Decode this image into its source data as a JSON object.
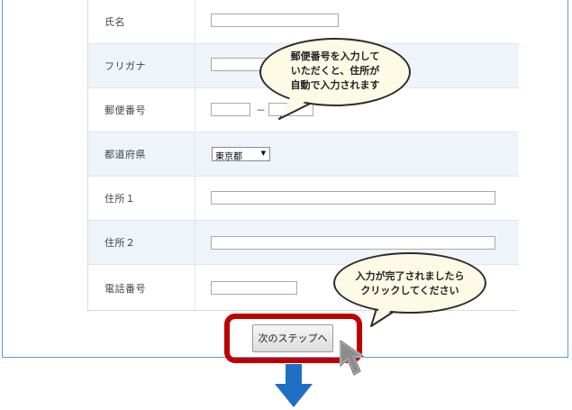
{
  "form": {
    "rows": [
      {
        "label": "氏名"
      },
      {
        "label": "フリガナ"
      },
      {
        "label": "郵便番号"
      },
      {
        "label": "都道府県"
      },
      {
        "label": "住所１"
      },
      {
        "label": "住所２"
      },
      {
        "label": "電話番号"
      }
    ],
    "postal_separator": "－",
    "prefecture": {
      "selected": "東京都"
    }
  },
  "callouts": {
    "postal": [
      "郵便番号を入力して",
      "いただくと、住所が",
      "自動で入力されます"
    ],
    "done": [
      "入力が完了されましたら",
      "クリックしてください"
    ]
  },
  "next_button": {
    "label": "次のステップへ"
  },
  "colors": {
    "frame_border": "#5b9bd5",
    "highlight": "#c00000",
    "arrow": "#1f6fc4",
    "bubble_fill": "#fdfbe6"
  },
  "icons": {
    "cursor": "pointer-cursor-icon",
    "arrow": "down-arrow-icon"
  }
}
